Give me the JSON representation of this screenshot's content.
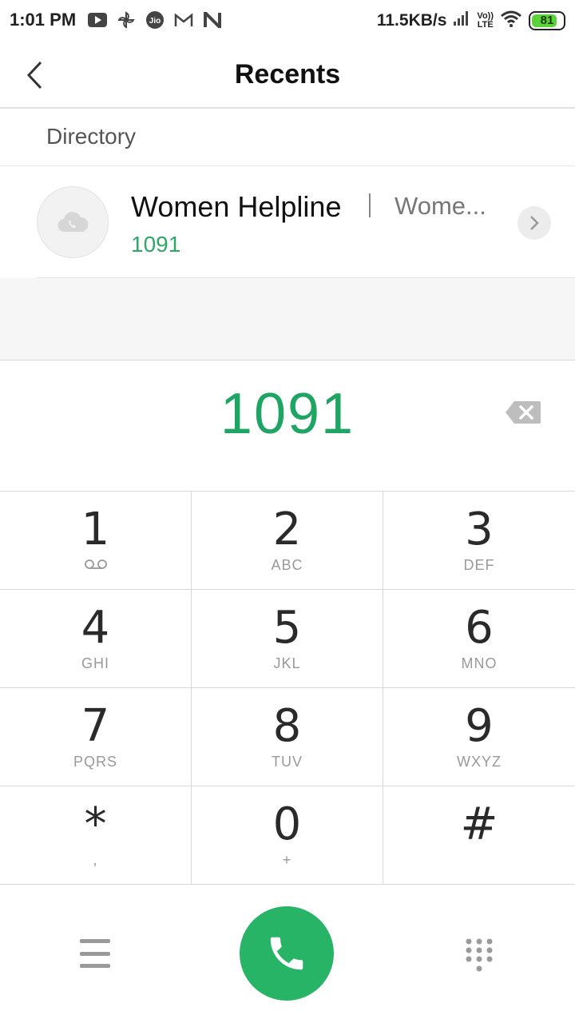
{
  "status_bar": {
    "time": "1:01 PM",
    "net_speed": "11.5KB/s",
    "volte_top": "Vo))",
    "volte_bottom": "LTE",
    "battery": "81",
    "icons": [
      "youtube-icon",
      "pinwheel-icon",
      "jio-icon",
      "gmail-icon",
      "n-icon",
      "signal-icon",
      "wifi-icon",
      "battery-icon"
    ]
  },
  "header": {
    "title": "Recents"
  },
  "directory": {
    "label": "Directory",
    "contact": {
      "name": "Women Helpline",
      "subtitle": "Wome...",
      "number": "1091"
    }
  },
  "dialer": {
    "typed_number": "1091",
    "keys": [
      {
        "digit": "1",
        "letters": ""
      },
      {
        "digit": "2",
        "letters": "ABC"
      },
      {
        "digit": "3",
        "letters": "DEF"
      },
      {
        "digit": "4",
        "letters": "GHI"
      },
      {
        "digit": "5",
        "letters": "JKL"
      },
      {
        "digit": "6",
        "letters": "MNO"
      },
      {
        "digit": "7",
        "letters": "PQRS"
      },
      {
        "digit": "8",
        "letters": "TUV"
      },
      {
        "digit": "9",
        "letters": "WXYZ"
      },
      {
        "digit": "*",
        "letters": ","
      },
      {
        "digit": "0",
        "letters": "+"
      },
      {
        "digit": "#",
        "letters": ""
      }
    ]
  },
  "colors": {
    "accent_green": "#27b466",
    "number_green": "#1ea463"
  }
}
